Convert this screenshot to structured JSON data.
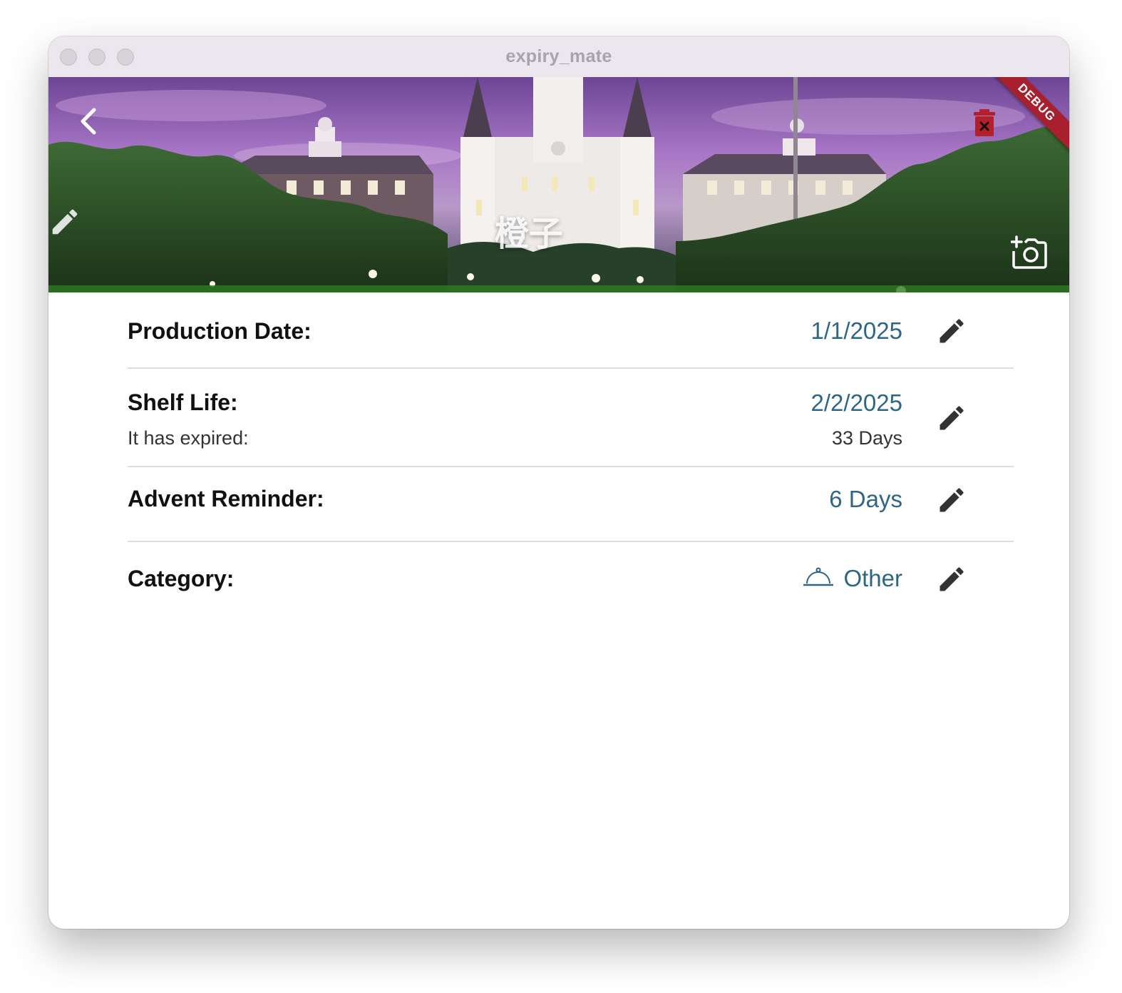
{
  "window": {
    "title": "expiry_mate"
  },
  "hero": {
    "title": "橙子",
    "debug_label": "DEBUG",
    "icons": {
      "back": "chevron-left-icon",
      "delete": "trash-icon",
      "edit": "pencil-icon",
      "camera": "add-photo-icon"
    }
  },
  "rows": {
    "production": {
      "label": "Production Date:",
      "value": "1/1/2025"
    },
    "shelf_life": {
      "label": "Shelf Life:",
      "sublabel": "It has expired:",
      "value": "2/2/2025",
      "subvalue": "33 Days"
    },
    "reminder": {
      "label": "Advent Reminder:",
      "value": "6 Days"
    },
    "category": {
      "label": "Category:",
      "value": "Other",
      "icon": "cloche-icon"
    }
  },
  "colors": {
    "value_text": "#2f6683",
    "debug_ribbon": "#a8202e",
    "delete_icon": "#b3202a",
    "edit_icon": "#333333"
  }
}
